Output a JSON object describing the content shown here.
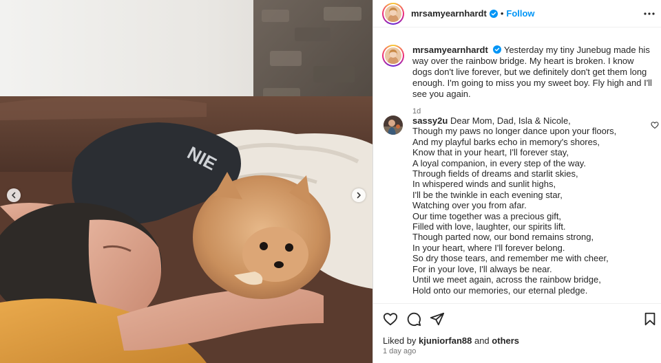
{
  "post": {
    "username": "mrsamyearnhardt",
    "separator": "•",
    "follow_label": "Follow",
    "more_icon": "more-horizontal-icon",
    "verified_icon": "verified-badge-icon"
  },
  "caption": {
    "username": "mrsamyearnhardt",
    "text": "Yesterday my tiny Junebug made his way over the rainbow bridge. My heart is broken. I know dogs don't live forever, but we definitely don't get them long enough. I'm going to miss you my sweet boy. Fly high and I'll see you again.",
    "time": "1d"
  },
  "comment": {
    "username": "sassy2u",
    "lines": [
      "Dear Mom, Dad, Isla & Nicole,",
      "Though my paws no longer dance upon your floors,",
      "And my playful barks echo in memory's shores,",
      "Know that in your heart, I'll forever stay,",
      "A loyal companion, in every step of the way.",
      "Through fields of dreams and starlit skies,",
      "In whispered winds and sunlit highs,",
      "I'll be the twinkle in each evening star,",
      "Watching over you from afar.",
      "Our time together was a precious gift,",
      "Filled with love, laughter, our spirits lift.",
      "Though parted now, our bond remains strong,",
      "In your heart, where I'll forever belong.",
      "So dry those tears, and remember me with cheer,",
      "For in your love, I'll always be near.",
      "Until we meet again, across the rainbow bridge,",
      "Hold onto our memories, our eternal pledge."
    ]
  },
  "likes": {
    "prefix": "Liked by",
    "user": "kjuniorfan88",
    "conjunction": "and",
    "others": "others"
  },
  "timestamp": "1 day ago",
  "colors": {
    "accent": "#0095f6",
    "verified": "#0095f6",
    "text": "#262626",
    "muted": "#737373"
  }
}
